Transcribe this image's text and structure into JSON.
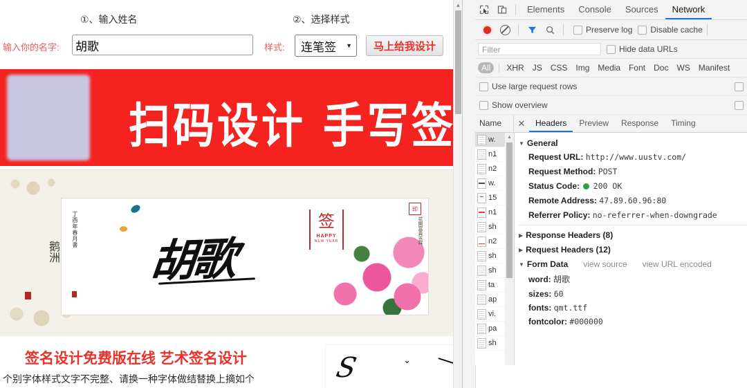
{
  "page": {
    "steps": [
      {
        "label": "①、输入姓名"
      },
      {
        "label": "②、选择样式"
      }
    ],
    "form": {
      "name_label": "输入你的名字:",
      "name_value": "胡歌",
      "name_placeholder": "",
      "style_label": "样式:",
      "style_value": "连笔签",
      "submit_label": "马上给我设计"
    },
    "banner": {
      "text": "扫码设计  手写签名"
    },
    "preview": {
      "scroll_left_text": "鹅洲",
      "signature": "胡歌",
      "seal_char": "签",
      "seal_happy": "HAPPY",
      "seal_newyear": "NEW YEAR",
      "corner_seal": "印"
    },
    "article": {
      "title": "签名设计免费版在线 艺术签名设计",
      "body": "个别字体样式文字不完整、请换一种字体做结替换上摘如个"
    }
  },
  "devtools": {
    "toolbar": {
      "inspect_icon": "inspect-element-icon",
      "device_icon": "device-toolbar-icon",
      "tabs": [
        {
          "label": "Elements",
          "active": false
        },
        {
          "label": "Console",
          "active": false
        },
        {
          "label": "Sources",
          "active": false
        },
        {
          "label": "Network",
          "active": true
        }
      ]
    },
    "network_toolbar": {
      "record_icon": "record-icon",
      "clear_icon": "clear-icon",
      "filter_icon": "filter-funnel-icon",
      "search_icon": "search-icon",
      "preserve_log": "Preserve log",
      "disable_cache": "Disable cache"
    },
    "filter": {
      "placeholder": "Filter",
      "hide_data_urls": "Hide data URLs"
    },
    "types": [
      "All",
      "XHR",
      "JS",
      "CSS",
      "Img",
      "Media",
      "Font",
      "Doc",
      "WS",
      "Manifest"
    ],
    "options": [
      {
        "label": "Use large request rows"
      },
      {
        "label": "Show overview"
      }
    ],
    "split": {
      "name_column": "Name",
      "close_label": "✕",
      "subtabs": [
        {
          "label": "Headers",
          "active": true
        },
        {
          "label": "Preview",
          "active": false
        },
        {
          "label": "Response",
          "active": false
        },
        {
          "label": "Timing",
          "active": false
        }
      ]
    },
    "requests": [
      {
        "name": "w.",
        "icon": "doc",
        "selected": true
      },
      {
        "name": "n1",
        "icon": "doc",
        "selected": false
      },
      {
        "name": "n2",
        "icon": "doc",
        "selected": false
      },
      {
        "name": "w.",
        "icon": "dark",
        "selected": false
      },
      {
        "name": "15",
        "icon": "tiny",
        "selected": false
      },
      {
        "name": "n1",
        "icon": "red",
        "selected": false
      },
      {
        "name": "sh",
        "icon": "doc",
        "selected": false
      },
      {
        "name": "n2",
        "icon": "redline",
        "selected": false
      },
      {
        "name": "sh",
        "icon": "doc",
        "selected": false
      },
      {
        "name": "sh",
        "icon": "doc",
        "selected": false
      },
      {
        "name": "ta",
        "icon": "doc",
        "selected": false
      },
      {
        "name": "ap",
        "icon": "doc",
        "selected": false
      },
      {
        "name": "vi.",
        "icon": "doc",
        "selected": false
      },
      {
        "name": "pa",
        "icon": "doc",
        "selected": false
      },
      {
        "name": "sh",
        "icon": "doc",
        "selected": false
      }
    ],
    "headers": {
      "general_title": "General",
      "general": [
        {
          "key": "Request URL:",
          "value": "http://www.uustv.com/",
          "mono": true
        },
        {
          "key": "Request Method:",
          "value": "POST",
          "mono": true
        },
        {
          "key": "Status Code:",
          "value": "200 OK",
          "mono": true,
          "status_dot": "#2ea03c"
        },
        {
          "key": "Remote Address:",
          "value": "47.89.60.96:80",
          "mono": true
        },
        {
          "key": "Referrer Policy:",
          "value": "no-referrer-when-downgrade",
          "mono": true
        }
      ],
      "response_headers": "Response Headers (8)",
      "request_headers": "Request Headers (12)",
      "form_data_title": "Form Data",
      "view_source": "view source",
      "view_url_encoded": "view URL encoded",
      "form_data": [
        {
          "key": "word:",
          "value": "胡歌",
          "mono": false
        },
        {
          "key": "sizes:",
          "value": "60",
          "mono": true
        },
        {
          "key": "fonts:",
          "value": "qmt.ttf",
          "mono": true
        },
        {
          "key": "fontcolor:",
          "value": "#000000",
          "mono": true
        }
      ]
    }
  },
  "colors": {
    "banner_red": "#f5231f",
    "accent_blue": "#1a73e8",
    "status_green": "#2ea03c",
    "link_red": "#e8322a"
  }
}
